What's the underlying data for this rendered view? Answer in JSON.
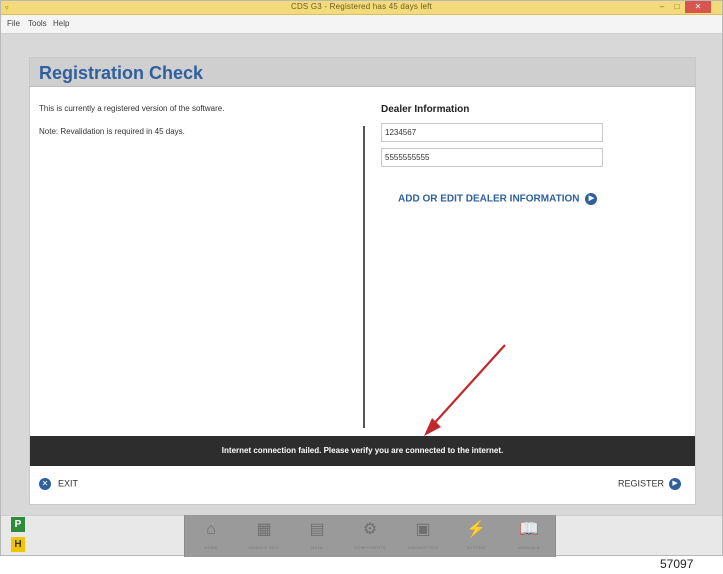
{
  "window": {
    "title": "CDS G3 - Registered has 45 days left",
    "controls": {
      "minimize": "–",
      "maximize": "□",
      "close": "✕"
    }
  },
  "menu": {
    "file": "File",
    "tools": "Tools",
    "help": "Help"
  },
  "page": {
    "title": "Registration Check",
    "status_line": "This is currently a registered version of the software.",
    "revalidation_note": "Note: Revalidation is required in 45 days."
  },
  "dealer": {
    "heading": "Dealer Information",
    "dealer_number": "1234567",
    "phone": "5555555555",
    "add_edit_label": "ADD OR EDIT DEALER INFORMATION"
  },
  "error": {
    "message": "Internet connection failed. Please verify you are connected to the internet."
  },
  "footer": {
    "exit_label": "EXIT",
    "register_label": "REGISTER"
  },
  "side_badges": {
    "p": "P",
    "h": "H"
  },
  "nav": [
    {
      "label": "HOME",
      "icon": "home-icon"
    },
    {
      "label": "MODULE INFO",
      "icon": "module-icon"
    },
    {
      "label": "DATA",
      "icon": "data-icon"
    },
    {
      "label": "COMPONENTS",
      "icon": "components-icon"
    },
    {
      "label": "DIAGNOSTICS",
      "icon": "diagnostics-icon"
    },
    {
      "label": "SYSTEM",
      "icon": "system-icon"
    },
    {
      "label": "MANUALS",
      "icon": "manuals-icon"
    }
  ],
  "figure_number": "57097",
  "colors": {
    "accent": "#2f5f9e",
    "title_bar": "#f3db7c",
    "error_banner": "#2d2d2d",
    "annotation_arrow": "#c0282b"
  }
}
